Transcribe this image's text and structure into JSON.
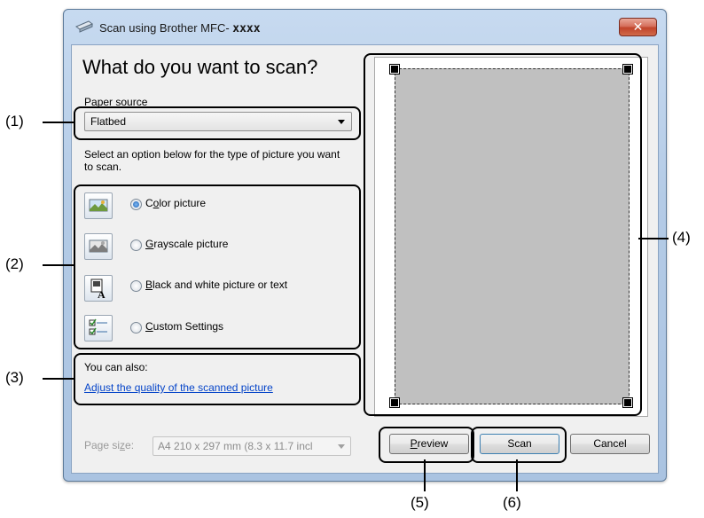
{
  "window": {
    "title_prefix": "Scan using Brother MFC- ",
    "title_model": "xxxx",
    "close_label": "✕"
  },
  "heading": "What do you want to scan?",
  "paper_source": {
    "label_prefix": "P",
    "label_underlined": "a",
    "label_rest": "per source",
    "value": "Flatbed"
  },
  "instruction": "Select an option below for the type of picture you want to scan.",
  "options": [
    {
      "pre": "C",
      "ul": "o",
      "post": "lor picture",
      "selected": true,
      "icon": "color-picture-icon"
    },
    {
      "pre": "",
      "ul": "G",
      "post": "rayscale picture",
      "selected": false,
      "icon": "grayscale-picture-icon"
    },
    {
      "pre": "",
      "ul": "B",
      "post": "lack and white picture or text",
      "selected": false,
      "icon": "black-white-text-icon"
    },
    {
      "pre": "",
      "ul": "C",
      "post": "ustom Settings",
      "selected": false,
      "icon": "custom-settings-icon"
    }
  ],
  "also": {
    "label": "You can also:",
    "link": "Adjust the quality of the scanned picture"
  },
  "page_size": {
    "label_pre": "Page si",
    "label_ul": "z",
    "label_post": "e:",
    "value": "A4 210 x 297 mm (8.3 x 11.7 incl"
  },
  "buttons": {
    "preview_ul": "P",
    "preview_rest": "review",
    "scan": "Scan",
    "cancel": "Cancel"
  },
  "callouts": {
    "c1": "(1)",
    "c2": "(2)",
    "c3": "(3)",
    "c4": "(4)",
    "c5": "(5)",
    "c6": "(6)"
  },
  "colors": {
    "link": "#0645c9",
    "close_button": "#c1442a",
    "preview_paper": "#c0c0c0"
  }
}
